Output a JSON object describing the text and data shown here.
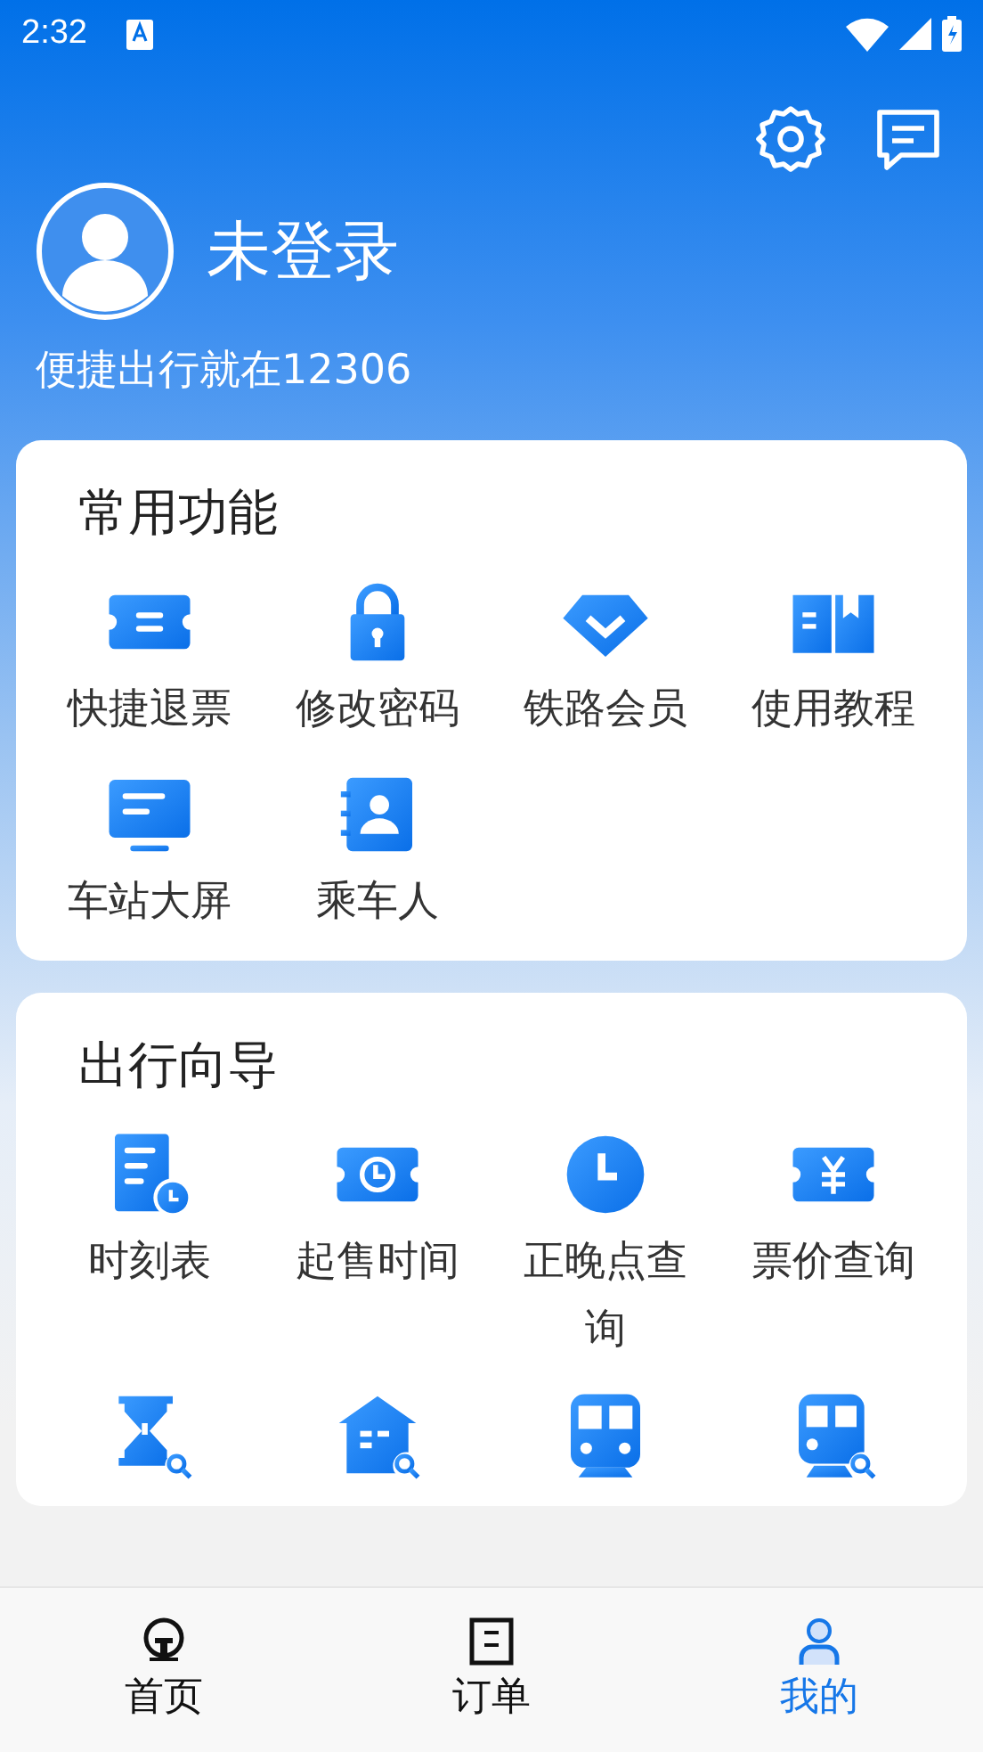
{
  "status_bar": {
    "time": "2:32"
  },
  "profile": {
    "name": "未登录",
    "tagline": "便捷出行就在12306"
  },
  "sections": [
    {
      "title": "常用功能",
      "items": [
        {
          "kind": "labeled",
          "label": "快捷退票"
        },
        {
          "kind": "labeled",
          "label": "修改密码"
        },
        {
          "kind": "labeled",
          "label": "铁路会员"
        },
        {
          "kind": "labeled",
          "label": "使用教程"
        },
        {
          "kind": "labeled",
          "label": "车站大屏"
        },
        {
          "kind": "labeled",
          "label": "乘车人"
        }
      ]
    },
    {
      "title": "出行向导",
      "items": [
        {
          "kind": "labeled",
          "label": "时刻表"
        },
        {
          "kind": "labeled",
          "label": "起售时间"
        },
        {
          "kind": "labeled",
          "label": "正晚点查询"
        },
        {
          "kind": "labeled",
          "label": "票价查询"
        },
        {
          "kind": "icon_only"
        },
        {
          "kind": "icon_only"
        },
        {
          "kind": "icon_only"
        },
        {
          "kind": "icon_only"
        }
      ]
    }
  ],
  "bottom_nav": [
    {
      "label": "首页",
      "selected": false
    },
    {
      "label": "订单",
      "selected": false
    },
    {
      "label": "我的",
      "selected": true
    }
  ]
}
